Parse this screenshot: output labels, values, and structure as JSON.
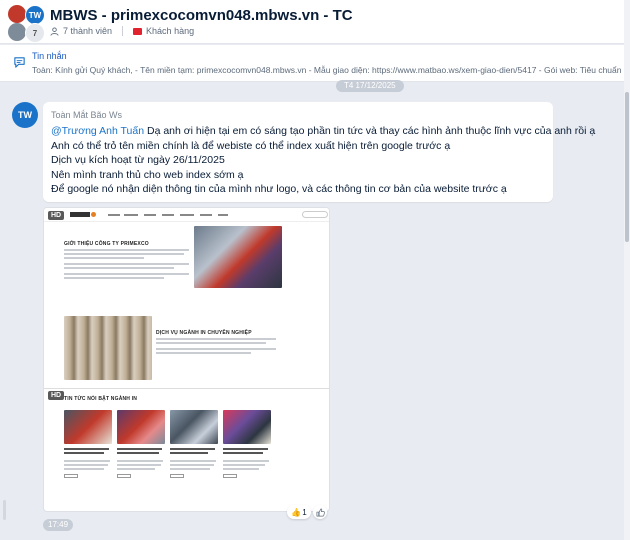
{
  "header": {
    "title": "MBWS - primexcocomvn048.mbws.vn - TC",
    "members": "7 thành viên",
    "label": "Khách hàng",
    "avatars": [
      "",
      "TW",
      "7",
      ""
    ]
  },
  "pinned": {
    "title": "Tin nhắn",
    "text": "Toàn: Kính gửi Quý khách, - Tên miền tạm: primexcocomvn048.mbws.vn - Mẫu giao diện: https://www.matbao.ws/xem-giao-dien/5417 - Gói web: Tiêu chuẩn - N"
  },
  "date_divider": "T4 17/12/2025",
  "message": {
    "avatar": "TW",
    "sender": "Toàn Mắt Bão Ws",
    "mention": "@Trương Anh Tuấn",
    "line1": " Dạ anh ơi hiện tại em có sáng tạo phần tin tức và thay các hình ảnh thuộc lĩnh vực của anh rồi ạ",
    "line2": "Anh có thể trỏ tên miền chính là để webiste có thể index xuất hiện trên google trước ạ",
    "line3": "Dịch vụ kích hoạt từ ngày 26/11/2025",
    "line4": "Nên mình tranh thủ cho web index sớm ạ",
    "line5": "Để google nó nhận diện thông tin của mình như logo, và các thông tin cơ bản của website trước ạ"
  },
  "image": {
    "hd_badge": "HD",
    "hd_badge2": "HD",
    "section1": "GIỚI THIỆU CÔNG TY PRIMEXCO",
    "section2": "DỊCH VỤ NGÀNH IN CHUYÊN NGHIỆP",
    "section3": "TIN TỨC NỔI BẬT NGÀNH IN"
  },
  "time": "17:49",
  "reaction": {
    "emoji": "👍",
    "count": "1"
  },
  "colors": {
    "accent": "#1a73c9",
    "tag": "#e0232e"
  }
}
